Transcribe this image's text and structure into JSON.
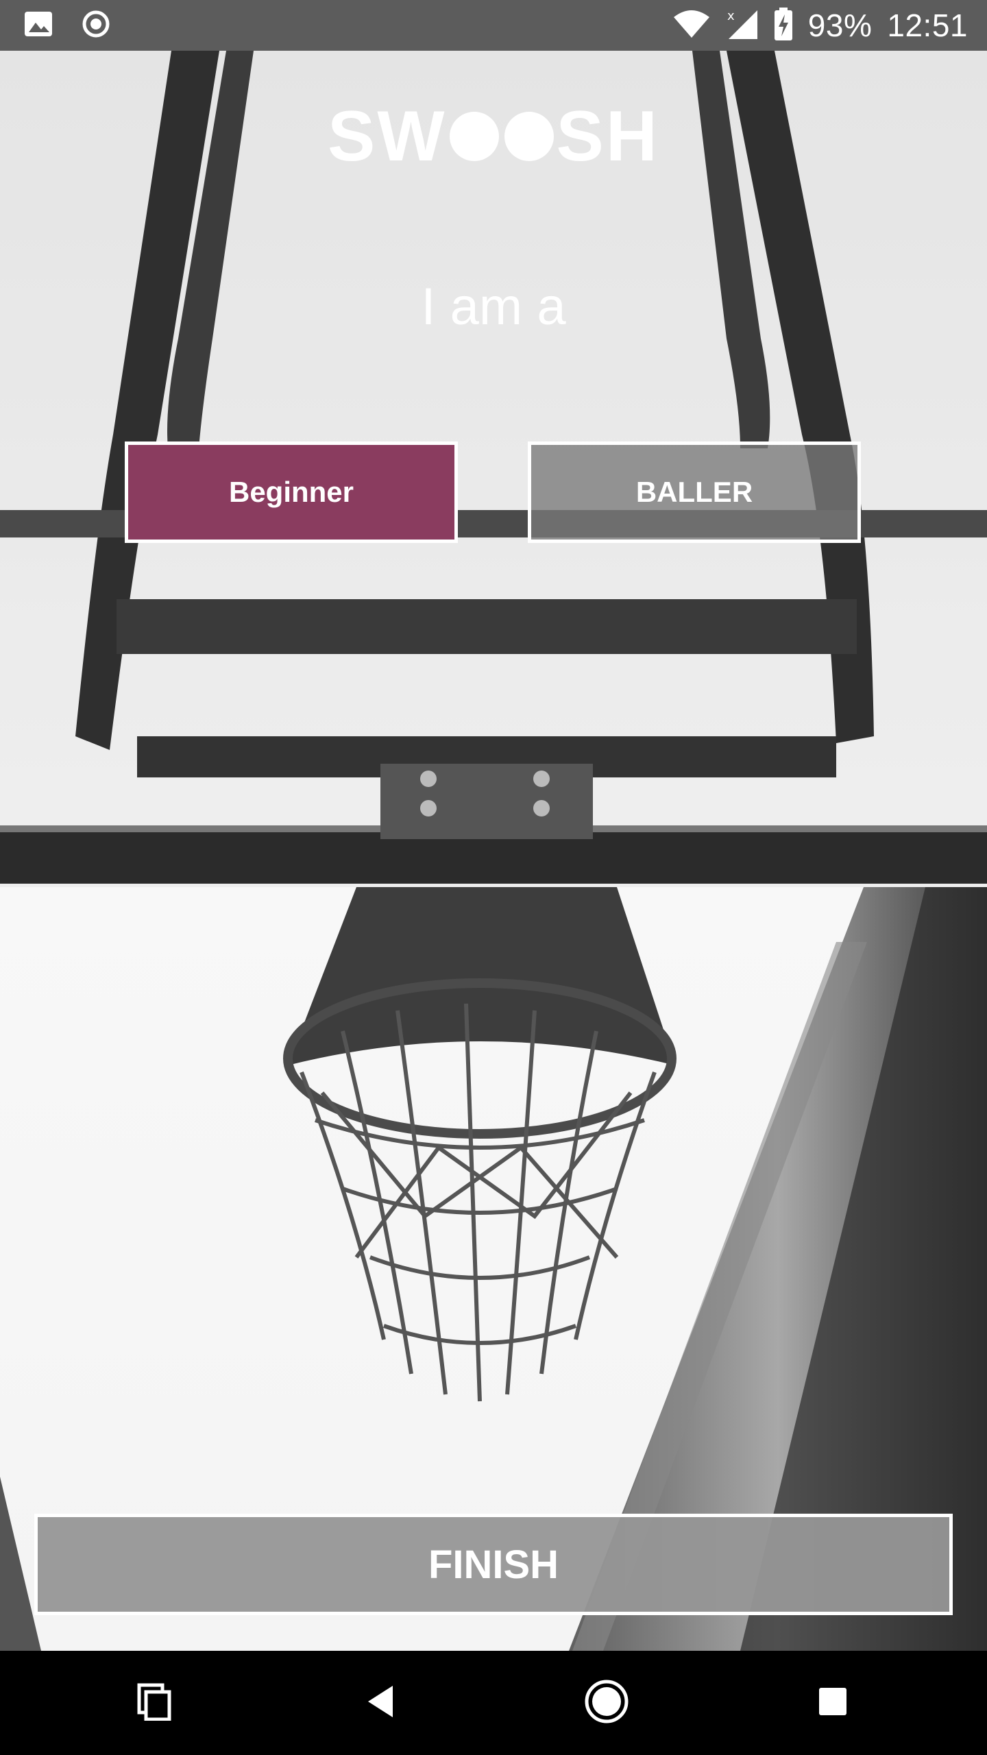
{
  "status_bar": {
    "battery_percent": "93%",
    "time": "12:51",
    "icons": [
      "image-icon",
      "sync-icon",
      "wifi-icon",
      "signal-icon",
      "battery-charging-icon"
    ]
  },
  "app": {
    "logo_text_left": "SW",
    "logo_text_right": "SH",
    "prompt": "I am a",
    "options": {
      "beginner_label": "Beginner",
      "baller_label": "BALLER"
    },
    "finish_label": "FINISH",
    "colors": {
      "selected": "#8a3c5f",
      "unselected": "#7a7a7a"
    }
  },
  "nav_bar": {
    "icons": [
      "recents-icon",
      "back-icon",
      "home-icon",
      "overview-icon"
    ]
  }
}
